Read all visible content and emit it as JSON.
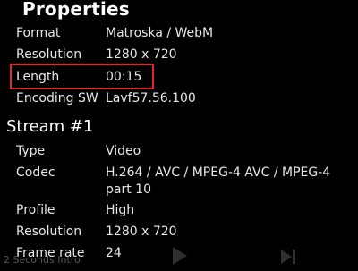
{
  "dialog": {
    "title": "Properties",
    "general": [
      {
        "key": "Format",
        "value": "Matroska / WebM"
      },
      {
        "key": "Resolution",
        "value": "1280 x 720"
      },
      {
        "key": "Length",
        "value": "00:15"
      },
      {
        "key": "Encoding SW",
        "value": "Lavf57.56.100"
      }
    ],
    "stream_title": "Stream #1",
    "stream": [
      {
        "key": "Type",
        "value": "Video"
      },
      {
        "key": "Codec",
        "value": "H.264 / AVC / MPEG-4 AVC / MPEG-4 part 10"
      },
      {
        "key": "Profile",
        "value": "High"
      },
      {
        "key": "Resolution",
        "value": "1280 x 720"
      },
      {
        "key": "Frame rate",
        "value": "24"
      }
    ]
  },
  "overlay": {
    "text": "2 Seconds Intro"
  },
  "colors": {
    "background": "#000000",
    "highlight_border": "#e0262b",
    "text": "#e8e8e8"
  },
  "icons": [
    "play-icon",
    "next-icon"
  ]
}
